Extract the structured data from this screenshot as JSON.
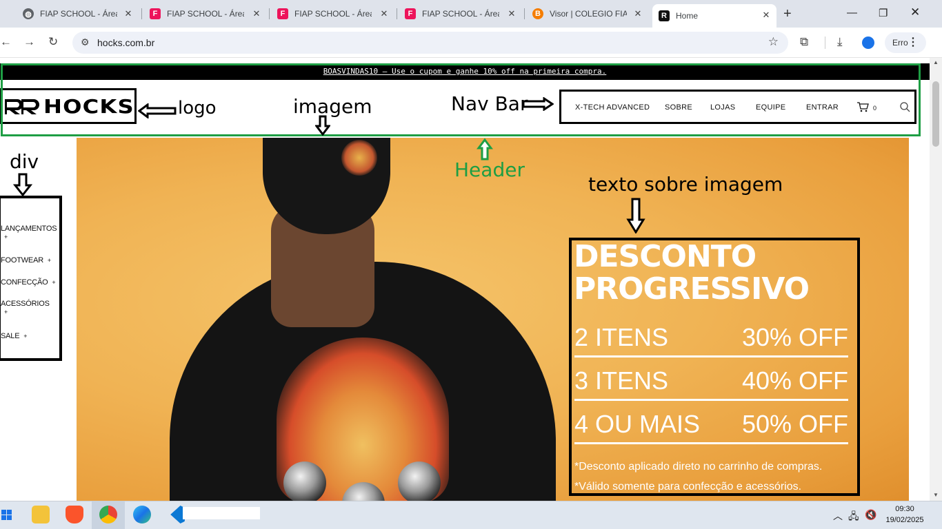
{
  "browser": {
    "tabs": [
      {
        "title": "FIAP SCHOOL - Área d",
        "icon": "globe-icon"
      },
      {
        "title": "FIAP SCHOOL - Área d",
        "icon": "fiap-icon"
      },
      {
        "title": "FIAP SCHOOL - Área d",
        "icon": "fiap-icon"
      },
      {
        "title": "FIAP SCHOOL - Área d",
        "icon": "fiap-icon"
      },
      {
        "title": "Visor | COLEGIO FIAP",
        "icon": "blogger-icon"
      },
      {
        "title": "Home",
        "icon": "hocks-icon",
        "active": true
      }
    ],
    "url": "hocks.com.br",
    "profile_label": "Erro"
  },
  "site": {
    "announcement": "BOASVINDAS10 – Use o cupom e ganhe 10% off na primeira compra.",
    "logo_text": "HOCKS",
    "nav": [
      "X-TECH ADVANCED",
      "SOBRE",
      "LOJAS",
      "EQUIPE",
      "ENTRAR"
    ],
    "cart_count": "0",
    "sidebar": [
      "LANÇAMENTOS",
      "FOOTWEAR",
      "CONFECÇÃO",
      "ACESSÓRIOS",
      "SALE"
    ],
    "promo": {
      "title_1": "DESCONTO",
      "title_2": "PROGRESSIVO",
      "rows": [
        {
          "left": "2 ITENS",
          "right": "30% OFF"
        },
        {
          "left": "3 ITENS",
          "right": "40% OFF"
        },
        {
          "left": "4 OU MAIS",
          "right": "50% OFF"
        }
      ],
      "note_1": "*Desconto aplicado direto no carrinho de compras.",
      "note_2": "*Válido somente para confecção e acessórios."
    }
  },
  "annotations": {
    "logo": "logo",
    "imagem": "imagem",
    "navbar": "Nav Bar",
    "header": "Header",
    "div": "div",
    "texto": "texto sobre imagem"
  },
  "colors": {
    "header_outline": "#1e9e44",
    "hero_orange": "#f0b354"
  },
  "taskbar": {
    "time": "09:30",
    "date": "19/02/2025"
  }
}
